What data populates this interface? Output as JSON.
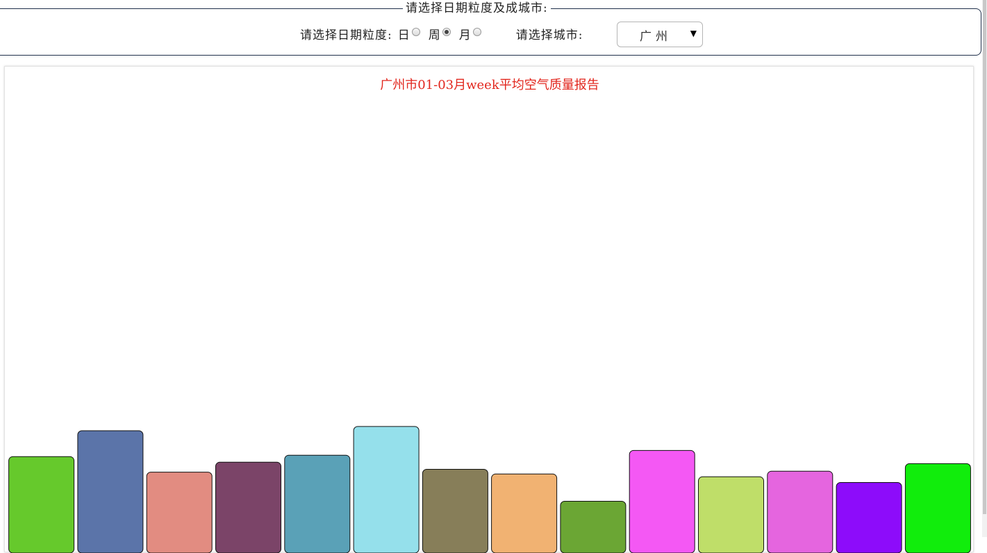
{
  "form": {
    "legend": "请选择日期粒度及成城市:",
    "granularity_label": "请选择日期粒度:",
    "granularity_options": [
      {
        "label": "日",
        "checked": false
      },
      {
        "label": "周",
        "checked": true
      },
      {
        "label": "月",
        "checked": false
      }
    ],
    "city_label": "请选择城市:",
    "city_value": "广州",
    "select_arrow_icon": "dropdown-arrow-icon"
  },
  "chart_data": {
    "type": "bar",
    "title": "广州市01-03月week平均空气质量报告",
    "xlabel": "",
    "ylabel": "",
    "ylim": [
      0,
      100
    ],
    "values": [
      20.5,
      26.0,
      17.2,
      19.3,
      20.8,
      26.9,
      17.8,
      16.8,
      11.0,
      21.8,
      16.2,
      17.4,
      15.0,
      19.0
    ],
    "colors": [
      "#66c92c",
      "#5b74a9",
      "#e28c81",
      "#7b4468",
      "#5aa1b7",
      "#95e0eb",
      "#877e59",
      "#f1b272",
      "#6ba634",
      "#f458f4",
      "#bfde69",
      "#e565df",
      "#8d0cfa",
      "#11ed0c"
    ]
  }
}
